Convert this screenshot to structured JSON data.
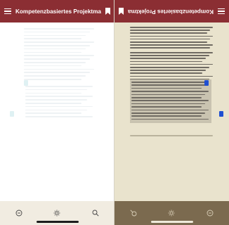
{
  "left_pane": {
    "title": "Kompetenzbasiertes Projektmana...",
    "menu_icon": "hamburger-icon",
    "bookmark_icon": "bookmark-icon",
    "bottom_icons": [
      "clock-icon",
      "brightness-icon",
      "search-icon"
    ]
  },
  "right_pane": {
    "title": "Kompetenzbasiertes Projektmana...",
    "bookmark_icon": "bookmark-icon",
    "menu_icon": "hamburger-icon",
    "orientation": "rotated-180",
    "bottom_icons": [
      "search-icon",
      "brightness-icon",
      "clock-icon"
    ]
  },
  "colors": {
    "toolbar": "#8b2e33",
    "page_sepia": "#e9e3cd",
    "bottom_left": "#f1ece1",
    "bottom_right": "#7b6a4f",
    "marker_blue": "#1f4fd1"
  }
}
